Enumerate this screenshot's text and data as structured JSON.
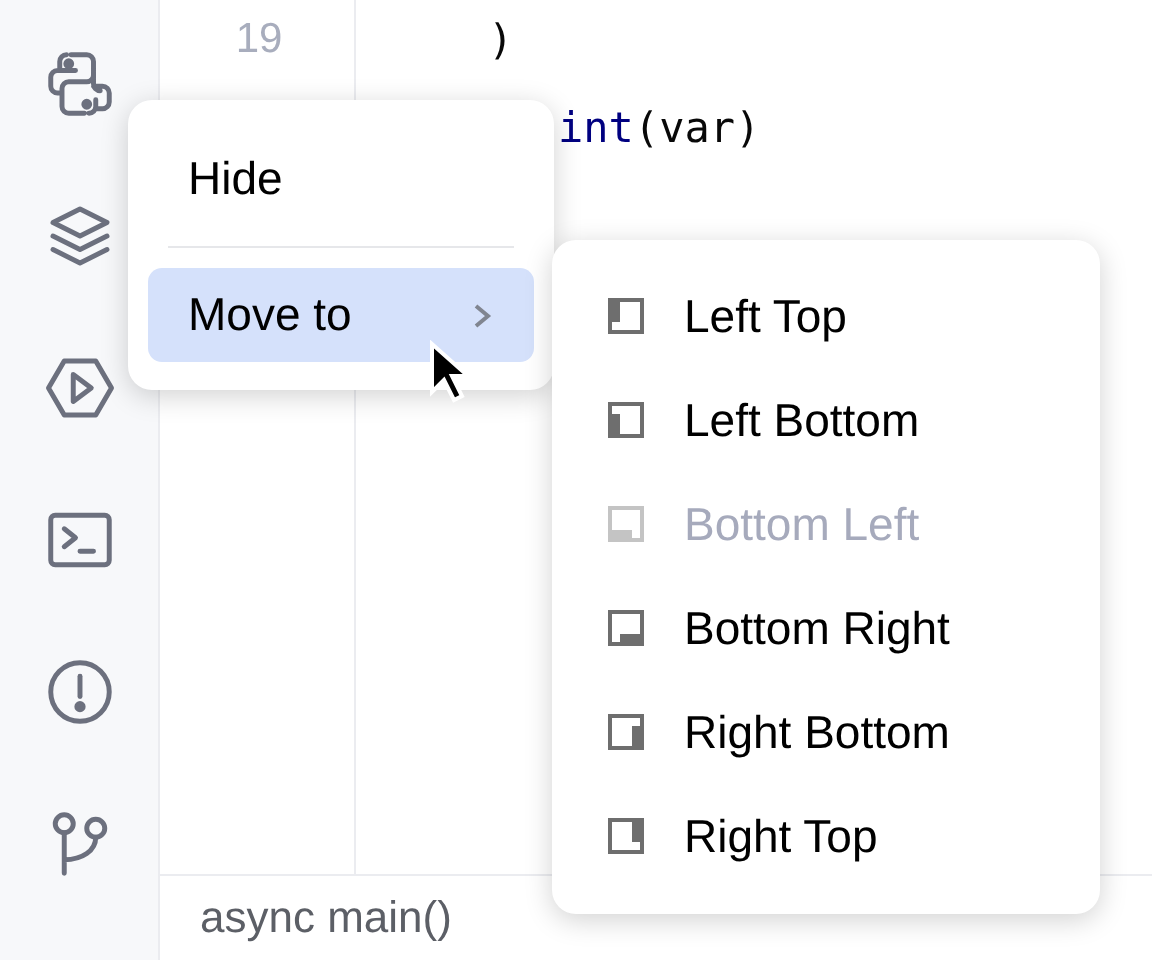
{
  "editor": {
    "lines": [
      {
        "number": "19",
        "tokens": [
          {
            "text": ")",
            "kind": "plain"
          }
        ]
      },
      {
        "tokens": [
          {
            "text": "int",
            "kind": "builtin"
          },
          {
            "text": "(var)",
            "kind": "plain"
          }
        ]
      }
    ]
  },
  "status_bar": {
    "breadcrumb": "async main()"
  },
  "context_menu": {
    "items": [
      {
        "label": "Hide",
        "selected": false,
        "submenu": false
      },
      {
        "label": "Move to",
        "selected": true,
        "submenu": true
      }
    ]
  },
  "submenu": {
    "items": [
      {
        "label": "Left Top",
        "kind": "left-top",
        "disabled": false
      },
      {
        "label": "Left Bottom",
        "kind": "left-bottom",
        "disabled": false
      },
      {
        "label": "Bottom Left",
        "kind": "bottom-left",
        "disabled": true
      },
      {
        "label": "Bottom Right",
        "kind": "bottom-right",
        "disabled": false
      },
      {
        "label": "Right Bottom",
        "kind": "right-bottom",
        "disabled": false
      },
      {
        "label": "Right Top",
        "kind": "right-top",
        "disabled": false
      }
    ]
  }
}
